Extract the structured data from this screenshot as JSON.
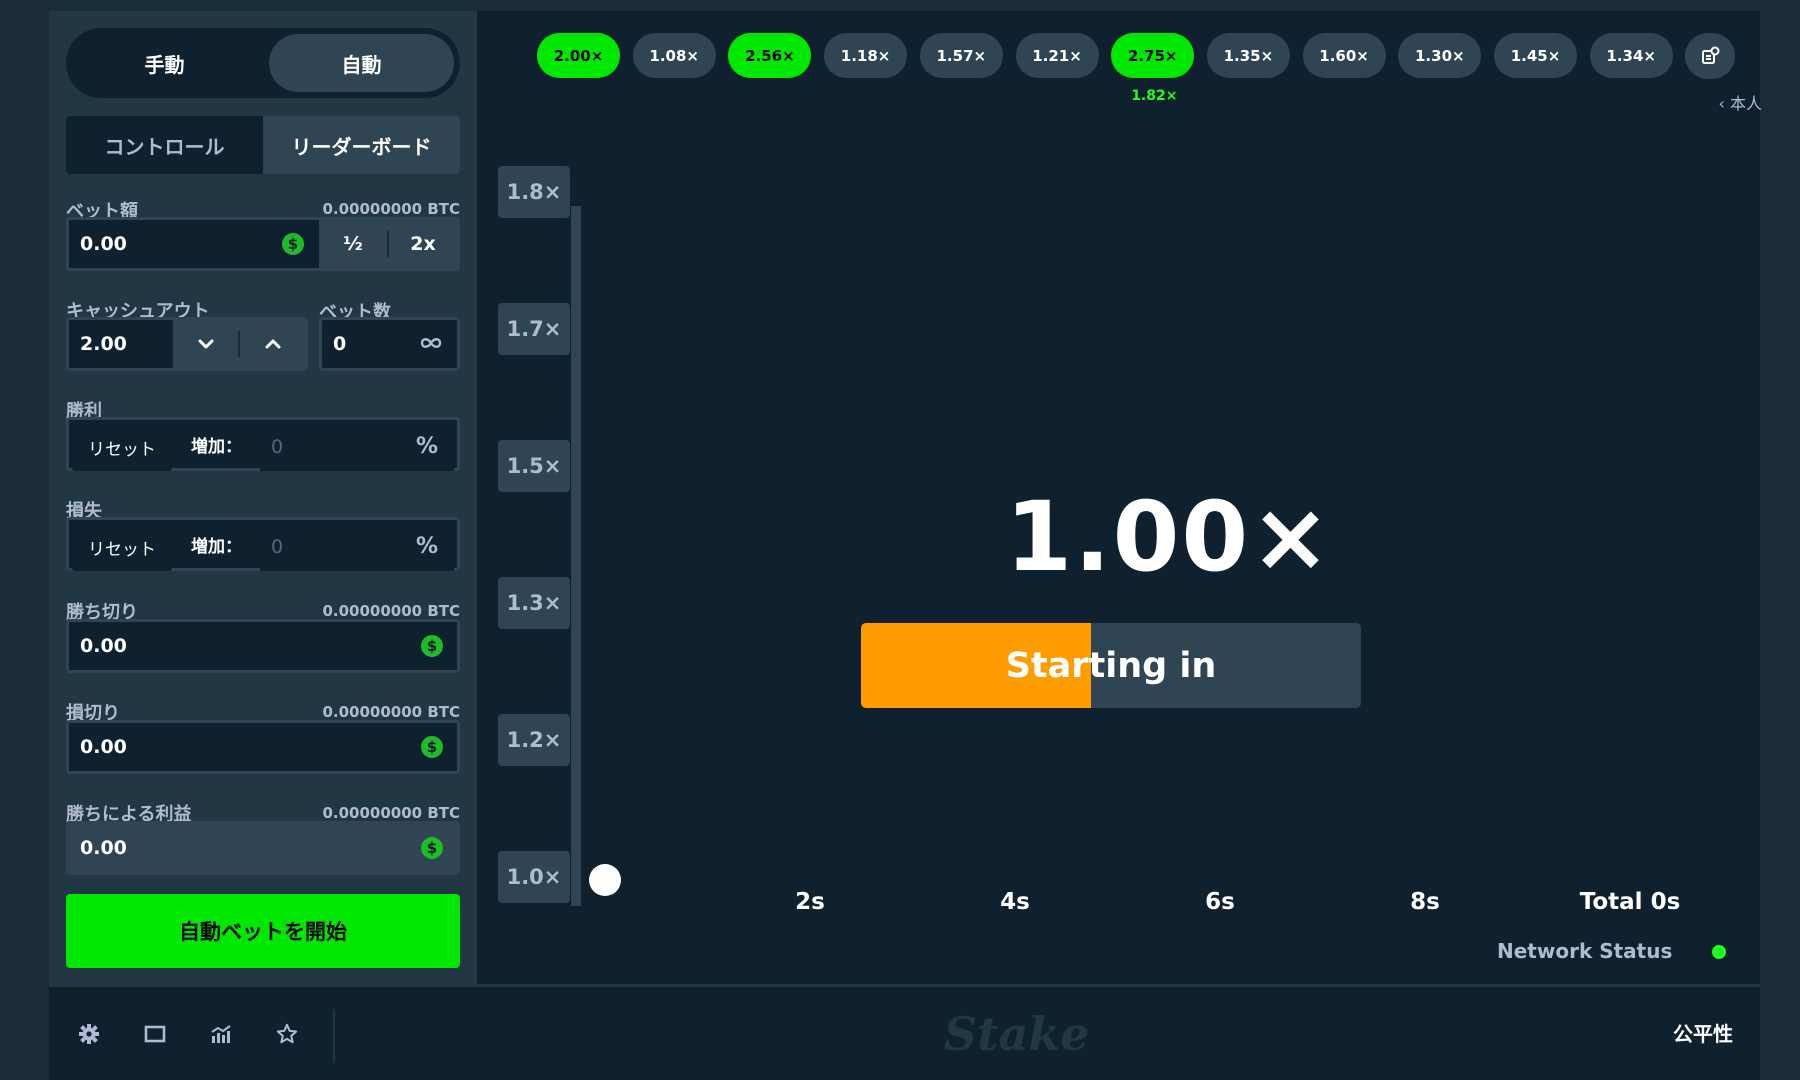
{
  "sidebar": {
    "mode_manual": "手動",
    "mode_auto": "自動",
    "tab_controls": "コントロール",
    "tab_leaderboard": "リーダーボード",
    "bet_amount_label": "ベット額",
    "bet_amount_btc": "0.00000000 BTC",
    "bet_amount_value": "0.00",
    "half_label": "½",
    "double_label": "2x",
    "cashout_label": "キャッシュアウト",
    "cashout_value": "2.00",
    "num_bets_label": "ベット数",
    "num_bets_value": "0",
    "on_win_label": "勝利",
    "on_loss_label": "損失",
    "reset_label": "リセット",
    "increase_label": "増加：",
    "increase_placeholder": "0",
    "percent_symbol": "%",
    "stop_profit_label": "勝ち切り",
    "stop_profit_btc": "0.00000000 BTC",
    "stop_profit_value": "0.00",
    "stop_loss_label": "損切り",
    "stop_loss_btc": "0.00000000 BTC",
    "stop_loss_value": "0.00",
    "win_profit_label": "勝ちによる利益",
    "win_profit_btc": "0.00000000 BTC",
    "win_profit_value": "0.00",
    "start_autobet_label": "自動ベットを開始",
    "currency_symbol": "$",
    "infinity_icon": "infinity-icon"
  },
  "history": {
    "pills": [
      "2.00×",
      "1.08×",
      "2.56×",
      "1.18×",
      "1.57×",
      "1.21×",
      "2.75×",
      "1.35×",
      "1.60×",
      "1.30×",
      "1.45×",
      "1.34×"
    ],
    "win_flags": [
      true,
      false,
      true,
      false,
      false,
      false,
      true,
      false,
      false,
      false,
      false,
      false
    ],
    "highlight_sub": "1.82×",
    "self_link": "‹ 本人",
    "history_icon": "history-icon"
  },
  "game": {
    "y_ticks": [
      "1.8×",
      "1.7×",
      "1.5×",
      "1.3×",
      "1.2×",
      "1.0×"
    ],
    "x_ticks": [
      "2s",
      "4s",
      "6s",
      "8s",
      "Total 0s"
    ],
    "multiplier": "1.00×",
    "progress_label": "Starting in",
    "progress_fraction": 0.46,
    "network_status_label": "Network Status",
    "network_status_color": "#1fff20"
  },
  "footer": {
    "icons": [
      "gear-icon",
      "theatre-mode-icon",
      "stats-icon",
      "star-icon"
    ],
    "logo": "Stake",
    "fairness_label": "公平性"
  },
  "colors": {
    "accent_green": "#00e701",
    "accent_orange": "#ff9d00",
    "panel": "#213743",
    "background": "#0f212e"
  }
}
